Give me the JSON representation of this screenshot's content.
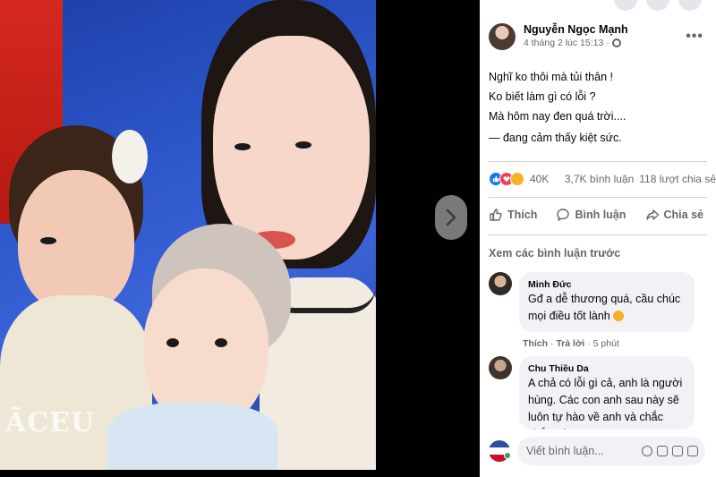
{
  "photo": {
    "watermark": "ÃCEU",
    "next_icon": "chevron-right-icon"
  },
  "post": {
    "author": "Nguyễn Ngọc Mạnh",
    "timestamp": "4 tháng 2 lúc 15:13",
    "privacy_icon": "globe-icon",
    "more_icon": "more-horizontal-icon",
    "more_label": "•••",
    "lines": [
      "Nghĩ ko thôi mà tủi thân !",
      "Ko biết làm gì có lỗi ?",
      "Mà hôm nay đen quá trời...."
    ],
    "feeling": "— đang cảm thấy kiệt sức."
  },
  "reactions": {
    "count": "40K",
    "comments": "3,7K bình luận",
    "shares": "118 lượt chia sẻ"
  },
  "actions": {
    "like": "Thích",
    "comment": "Bình luận",
    "share": "Chia sẻ"
  },
  "comments_section": {
    "view_previous": "Xem các bình luận trước",
    "comments": [
      {
        "author": "Minh Đức",
        "text": "Gđ a dễ thương quá, cầu chúc mọi điều tốt lành",
        "like": "Thích",
        "reply": "Trả lời",
        "time": "5 phút"
      },
      {
        "author": "Chu Thiều Da",
        "text": "A chả có lỗi gì cả, anh là người hùng. Các con anh sau này sẽ luôn tự hào về anh và chắc chắn các"
      }
    ]
  },
  "composer": {
    "placeholder": "Viết bình luận..."
  },
  "colors": {
    "accent": "#1877f2",
    "secondary_text": "#65676b",
    "bubble": "#f0f2f5"
  }
}
